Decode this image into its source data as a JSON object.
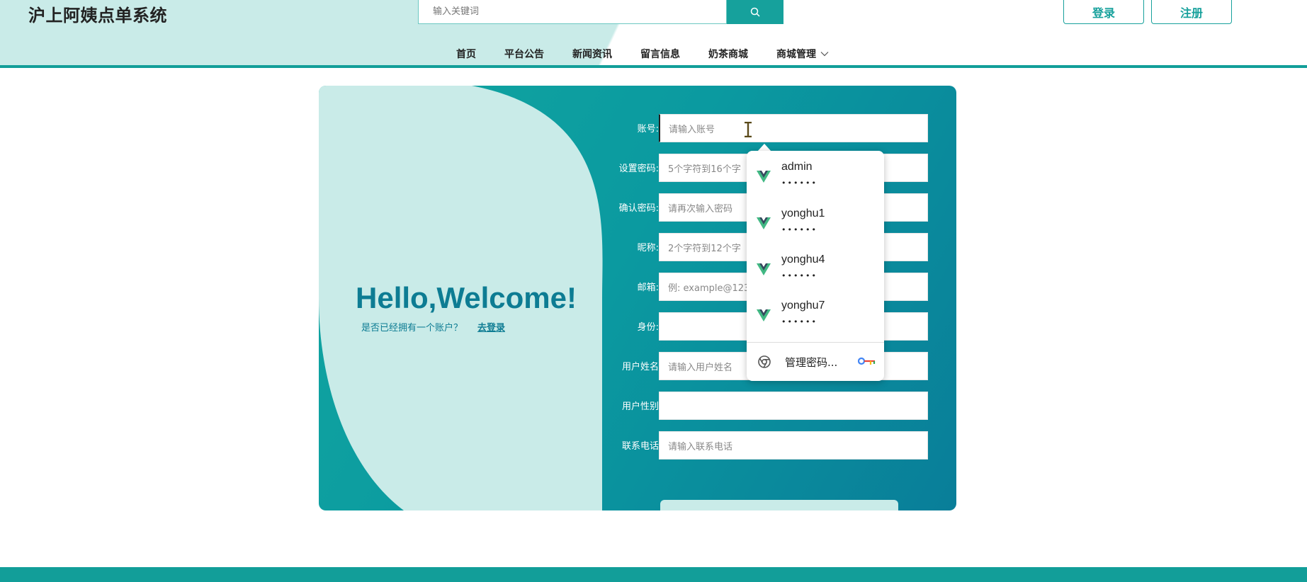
{
  "header": {
    "logo": "沪上阿姨点单系统",
    "search_placeholder": "输入关键词",
    "login_label": "登录",
    "register_label": "注册"
  },
  "nav": {
    "items": [
      "首页",
      "平台公告",
      "新闻资讯",
      "留言信息",
      "奶茶商城",
      "商城管理"
    ]
  },
  "welcome": {
    "title": "Hello,Welcome!",
    "question": "是否已经拥有一个账户？",
    "login_link": "去登录"
  },
  "form": {
    "fields": [
      {
        "label": "账号:",
        "placeholder": "请输入账号"
      },
      {
        "label": "设置密码:",
        "placeholder": "5个字符到16个字"
      },
      {
        "label": "确认密码:",
        "placeholder": "请再次输入密码"
      },
      {
        "label": "昵称:",
        "placeholder": "2个字符到12个字"
      },
      {
        "label": "邮箱:",
        "placeholder": "例: example@123"
      },
      {
        "label": "身份:",
        "placeholder": ""
      },
      {
        "label": "用户姓名",
        "placeholder": "请输入用户姓名"
      },
      {
        "label": "用户性别",
        "placeholder": ""
      },
      {
        "label": "联系电话",
        "placeholder": "请输入联系电话"
      }
    ]
  },
  "password_popup": {
    "entries": [
      {
        "username": "admin",
        "mask": "••••••"
      },
      {
        "username": "yonghu1",
        "mask": "••••••"
      },
      {
        "username": "yonghu4",
        "mask": "••••••"
      },
      {
        "username": "yonghu7",
        "mask": "••••••"
      }
    ],
    "manage_label": "管理密码..."
  },
  "colors": {
    "brand": "#129e99",
    "accent_text": "#0d7c93",
    "light_bg": "#c9ebe8"
  }
}
